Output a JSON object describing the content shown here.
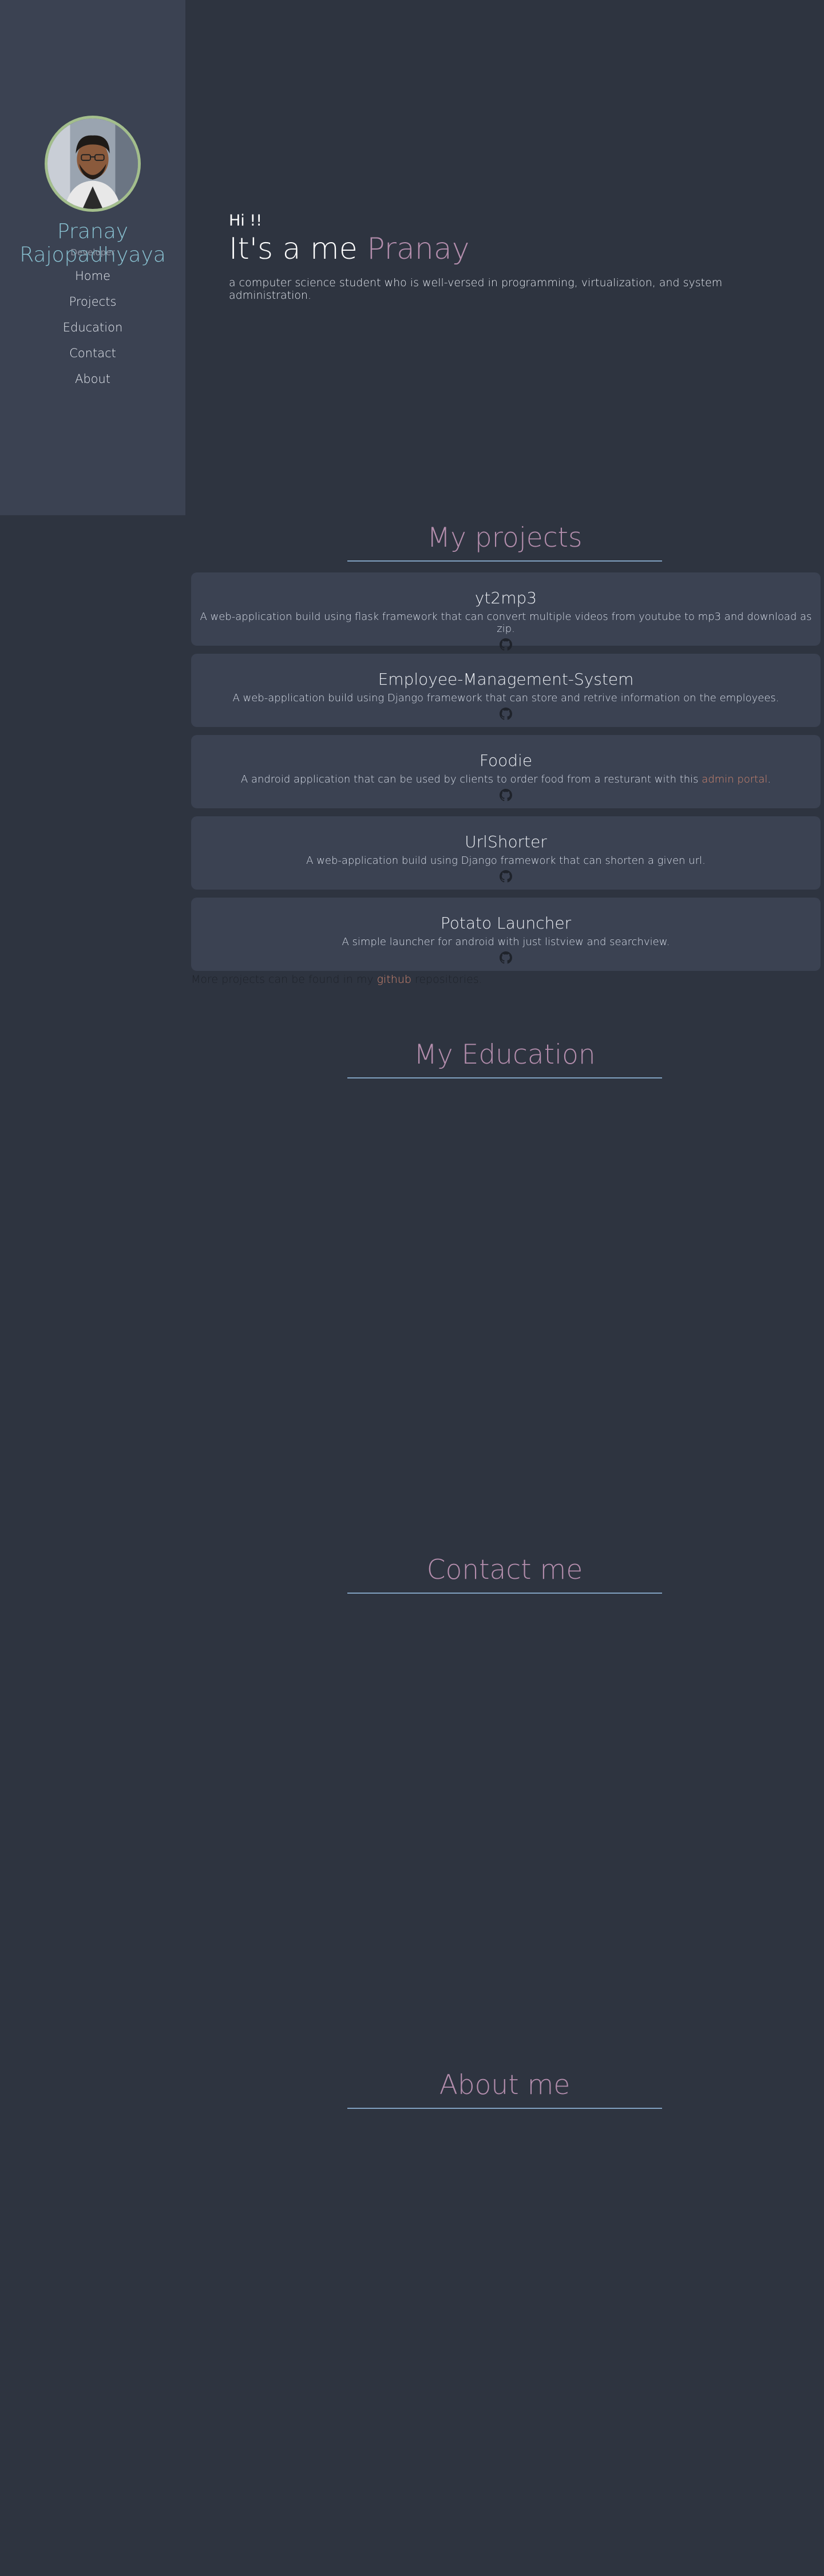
{
  "sidebar": {
    "name": "Pranay Rajopadhyaya",
    "role": "Developer",
    "nav": [
      "Home",
      "Projects",
      "Education",
      "Contact",
      "About"
    ]
  },
  "hero": {
    "greeting": "Hi !!",
    "title_prefix": "It's a me",
    "title_name": "Pranay",
    "description": "a computer science student who is well-versed in programming, virtualization, and system administration."
  },
  "sections": {
    "projects": "My projects",
    "education": "My Education",
    "contact": "Contact me",
    "about": "About me"
  },
  "projects": [
    {
      "title": "yt2mp3",
      "desc": "A web-application build using flask framework that can convert multiple videos from youtube to mp3 and download as zip.",
      "icon": "github-icon"
    },
    {
      "title": "Employee-Management-System",
      "desc": "A web-application build using Django framework that can store and retrive information on the employees.",
      "icon": "github-icon"
    },
    {
      "title": "Foodie",
      "desc_before": "A android application that can be used by clients to order food from a resturant with this",
      "desc_link": "admin portal",
      "desc_after": ".",
      "icon": "github-icon"
    },
    {
      "title": "UrlShorter",
      "desc": "A web-application build using Django framework that can shorten a given url.",
      "icon": "github-icon"
    },
    {
      "title": "Potato Launcher",
      "desc": "A simple launcher for android with just listview and searchview.",
      "icon": "github-icon"
    }
  ],
  "more": {
    "before": "More projects can be found in my",
    "link": "github",
    "after": "repositories."
  },
  "colors": {
    "background": "#2e3440",
    "sidebar": "#3b4252",
    "accent": "#b48ead",
    "name": "#88c0d0",
    "link": "#d08770",
    "avatar_border": "#a3be8c"
  }
}
